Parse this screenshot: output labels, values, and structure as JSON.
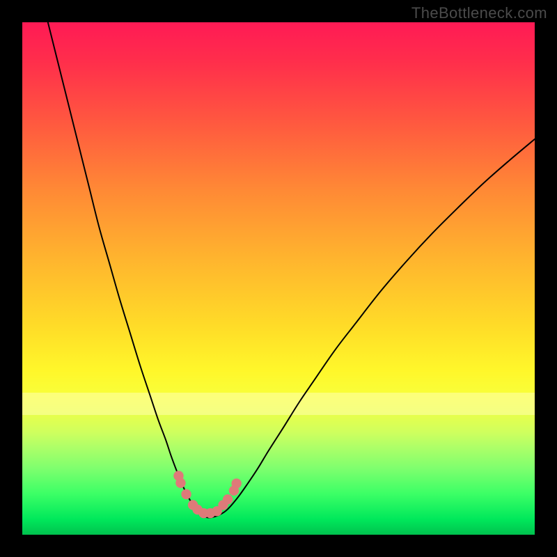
{
  "watermark": {
    "text": "TheBottleneck.com"
  },
  "colors": {
    "watermark": "#4b4b4b",
    "curve_stroke": "#000000",
    "bead_fill": "#de7a79",
    "bead_stroke": "#de7a79",
    "frame_bg": "#000000"
  },
  "chart_data": {
    "type": "line",
    "title": "",
    "xlabel": "",
    "ylabel": "",
    "xlim": [
      0,
      100
    ],
    "ylim": [
      0,
      100
    ],
    "grid": false,
    "legend": false,
    "series": [
      {
        "name": "bottleneck-curve",
        "x": [
          5,
          7,
          9,
          11,
          13,
          15,
          17,
          19,
          21,
          23,
          25,
          26.5,
          28,
          29,
          30,
          31,
          32,
          33,
          34,
          35,
          36,
          37,
          38.5,
          40,
          42,
          44,
          46,
          48,
          51,
          54,
          57,
          61,
          65,
          70,
          75,
          80,
          85,
          90,
          95,
          100
        ],
        "y": [
          100,
          92,
          84,
          76,
          68,
          60,
          53,
          46,
          39.5,
          33,
          27,
          22.5,
          18.5,
          15.5,
          12.8,
          10.3,
          8.1,
          6.3,
          4.9,
          3.9,
          3.4,
          3.4,
          3.9,
          4.9,
          7.2,
          10.0,
          13.0,
          16.3,
          21.0,
          25.8,
          30.2,
          36.0,
          41.2,
          47.6,
          53.4,
          58.8,
          63.8,
          68.6,
          73.0,
          77.2
        ]
      }
    ],
    "annotations": {
      "beads": [
        {
          "x": 30.5,
          "y": 11.5
        },
        {
          "x": 30.9,
          "y": 10.1
        },
        {
          "x": 32.0,
          "y": 7.9
        },
        {
          "x": 33.3,
          "y": 5.8
        },
        {
          "x": 34.2,
          "y": 4.9
        },
        {
          "x": 35.4,
          "y": 4.2
        },
        {
          "x": 36.7,
          "y": 4.2
        },
        {
          "x": 38.0,
          "y": 4.6
        },
        {
          "x": 39.2,
          "y": 5.8
        },
        {
          "x": 40.1,
          "y": 6.9
        },
        {
          "x": 41.3,
          "y": 8.6
        },
        {
          "x": 41.8,
          "y": 10.0
        }
      ]
    }
  }
}
